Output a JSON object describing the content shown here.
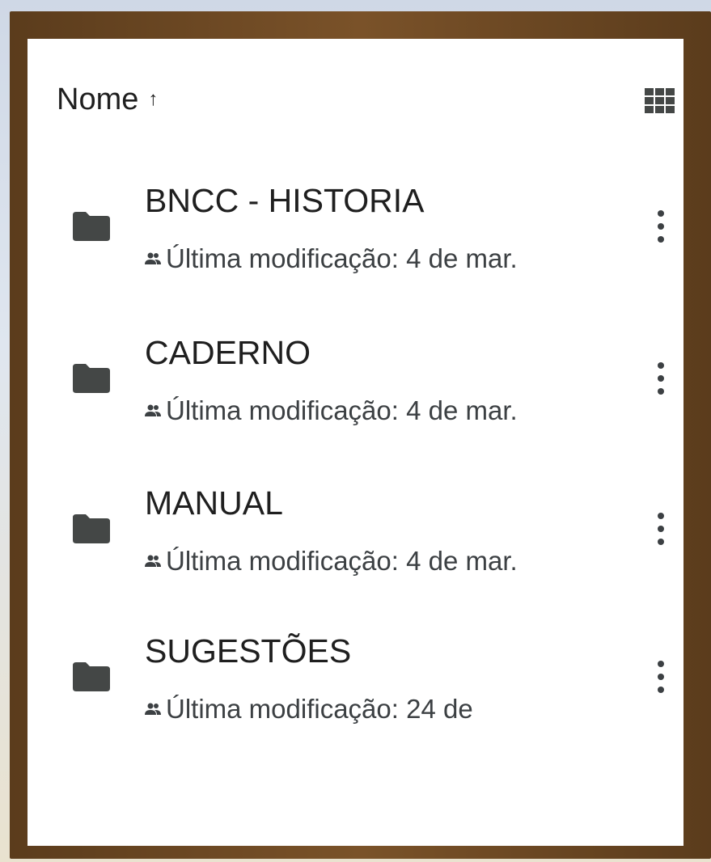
{
  "header": {
    "sort_label": "Nome",
    "sort_direction_icon": "arrow-up-icon",
    "view_toggle_icon": "grid-view-icon"
  },
  "files": [
    {
      "name": "BNCC - HISTORIA",
      "meta": "Última modificação: 4 de mar.",
      "type_icon": "folder-icon",
      "shared_icon": "people-icon"
    },
    {
      "name": "CADERNO",
      "meta": "Última modificação: 4 de mar.",
      "type_icon": "folder-icon",
      "shared_icon": "people-icon"
    },
    {
      "name": "MANUAL",
      "meta": "Última modificação: 4 de mar.",
      "type_icon": "folder-icon",
      "shared_icon": "people-icon"
    },
    {
      "name": "SUGESTÕES",
      "meta": "Última modificação: 24 de",
      "type_icon": "folder-icon",
      "shared_icon": "people-icon"
    }
  ],
  "colors": {
    "frame": "#6b4623",
    "panel": "#ffffff",
    "icon": "#444746",
    "text": "#1f1f1f"
  }
}
